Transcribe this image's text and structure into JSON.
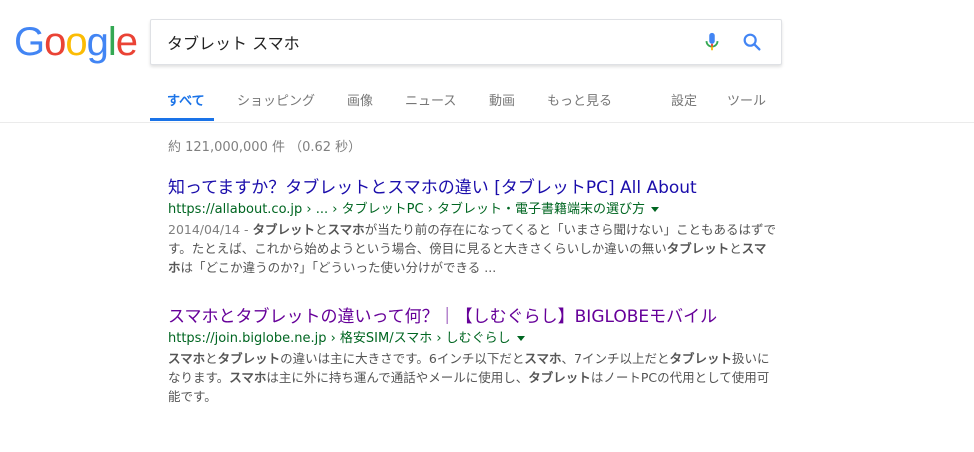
{
  "logo": {
    "letters": [
      "G",
      "o",
      "o",
      "g",
      "l",
      "e"
    ]
  },
  "search": {
    "query": "タブレット スマホ",
    "placeholder": ""
  },
  "icons": {
    "mic": "microphone-icon",
    "search": "magnifier-search-icon"
  },
  "tabs": [
    {
      "label": "すべて",
      "active": true
    },
    {
      "label": "ショッピング"
    },
    {
      "label": "画像"
    },
    {
      "label": "ニュース"
    },
    {
      "label": "動画"
    },
    {
      "label": "もっと見る"
    },
    {
      "label": "設定"
    },
    {
      "label": "ツール"
    }
  ],
  "result_stats": "約 121,000,000 件 （0.62 秒）",
  "results": [
    {
      "title": "知ってますか？タブレットとスマホの違い [タブレットPC] All About",
      "url": "https://allabout.co.jp › ... › タブレットPC › タブレット・電子書籍端末の選び方",
      "date": "2014/04/14 - ",
      "snippet_parts": [
        {
          "text": "タブレット",
          "bold": true
        },
        {
          "text": "と",
          "bold": false
        },
        {
          "text": "スマホ",
          "bold": true
        },
        {
          "text": "が当たり前の存在になってくると「いまさら聞けない」こともあるはずです。たとえば、これから始めようという場合、傍目に見ると大きさくらいしか違いの無い",
          "bold": false
        },
        {
          "text": "タブレット",
          "bold": true
        },
        {
          "text": "と",
          "bold": false
        },
        {
          "text": "スマホ",
          "bold": true
        },
        {
          "text": "は「どこか違うのか?」「どういった使い分けができる ...",
          "bold": false
        }
      ]
    },
    {
      "title": "スマホとタブレットの違いって何？｜【しむぐらし】BIGLOBEモバイル",
      "url": "https://join.biglobe.ne.jp › 格安SIM/スマホ › しむぐらし",
      "date": "",
      "snippet_parts": [
        {
          "text": "スマホ",
          "bold": true
        },
        {
          "text": "と",
          "bold": false
        },
        {
          "text": "タブレット",
          "bold": true
        },
        {
          "text": "の違いは主に大きさです。6インチ以下だと",
          "bold": false
        },
        {
          "text": "スマホ",
          "bold": true
        },
        {
          "text": "、7インチ以上だと",
          "bold": false
        },
        {
          "text": "タブレット",
          "bold": true
        },
        {
          "text": "扱いになります。",
          "bold": false
        },
        {
          "text": "スマホ",
          "bold": true
        },
        {
          "text": "は主に外に持ち運んで通話やメールに使用し、",
          "bold": false
        },
        {
          "text": "タブレット",
          "bold": true
        },
        {
          "text": "はノートPCの代用として使用可能です。",
          "bold": false
        }
      ]
    }
  ],
  "colors": {
    "link": "#1a0dab",
    "visited": "#609",
    "url": "#006621",
    "active_tab": "#1a73e8"
  }
}
